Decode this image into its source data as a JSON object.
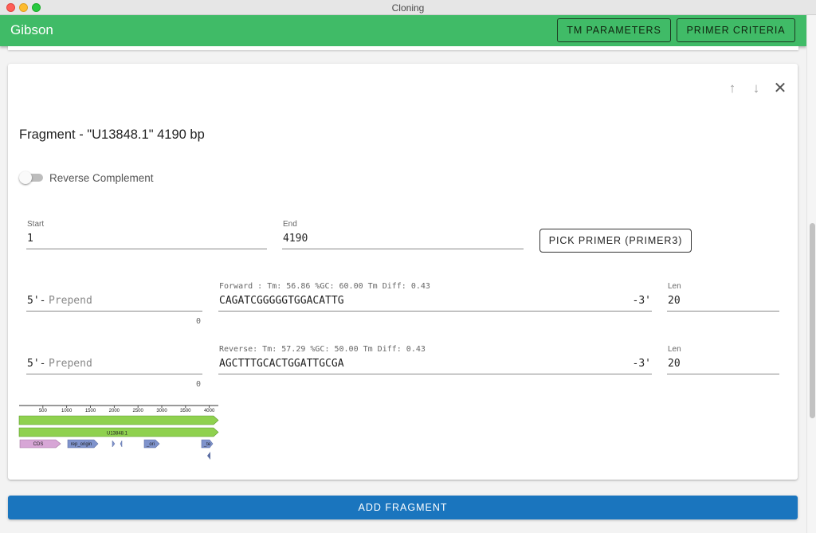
{
  "window": {
    "title": "Cloning"
  },
  "appbar": {
    "title": "Gibson",
    "tm_parameters": "TM PARAMETERS",
    "primer_criteria": "PRIMER CRITERIA"
  },
  "fragment": {
    "title": "Fragment - \"U13848.1\" 4190 bp",
    "reverse_complement_label": "Reverse Complement",
    "reverse_complement_on": false,
    "start": {
      "label": "Start",
      "value": "1"
    },
    "end": {
      "label": "End",
      "value": "4190"
    },
    "pick_primer_label": "PICK PRIMER (PRIMER3)",
    "forward": {
      "prefix": "5'-",
      "prepend_placeholder": "Prepend",
      "prepend_count": "0",
      "info": "Forward : Tm: 56.86 %GC: 60.00 Tm Diff: 0.43",
      "sequence": "CAGATCGGGGGTGGACATTG",
      "suffix": "-3'",
      "len_label": "Len",
      "len_value": "20"
    },
    "reverse": {
      "prefix": "5'-",
      "prepend_placeholder": "Prepend",
      "prepend_count": "0",
      "info": "Reverse: Tm: 57.29 %GC: 50.00 Tm Diff: 0.43",
      "sequence": "AGCTTTGCACTGGATTGCGA",
      "suffix": "-3'",
      "len_label": "Len",
      "len_value": "20"
    },
    "map": {
      "ticks": [
        "500",
        "1000",
        "1500",
        "2000",
        "2500",
        "3000",
        "3500",
        "4000"
      ],
      "track_label": "U13848.1",
      "features": {
        "cds": "CDS",
        "rep_origin": "rep_origin",
        "ori": "_ori",
        "te": "_te"
      },
      "colors": {
        "track": "#8fd14f",
        "cds": "#d7a6d6",
        "feature": "#7f93cc"
      }
    }
  },
  "add_fragment_label": "ADD FRAGMENT"
}
